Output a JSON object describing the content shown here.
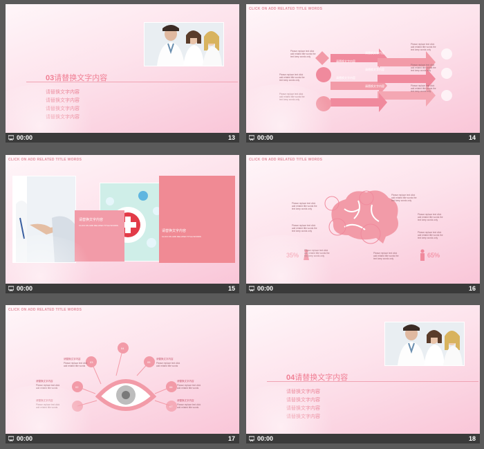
{
  "common": {
    "time": "00:00",
    "header_en": "CLICK ON ADD RELATED TITLE WORDS"
  },
  "slides": [
    {
      "num": "13",
      "section_num": "03",
      "section_title": "请替换文字内容",
      "items": [
        "请替换文字内容",
        "请替换文字内容",
        "请替换文字内容",
        "请替换文字内容"
      ]
    },
    {
      "num": "14",
      "arrow_label": "请替换文字内容",
      "blurb": "Please replace text click add related title words the text keep words only"
    },
    {
      "num": "15",
      "box_title": "请替换文字内容",
      "box_text": "CLICK ON ADD RELATED TITLE WORDS"
    },
    {
      "num": "16",
      "pct_left": "35%",
      "pct_right": "65%",
      "blurb": "Please replace text click add related title words the text keep words only"
    },
    {
      "num": "17",
      "eye_label": "请替换文字内容",
      "nodes": [
        "01",
        "02",
        "03",
        "04",
        "05",
        "06",
        "07"
      ],
      "blurb": "Please replace text click add related title words"
    },
    {
      "num": "18",
      "section_num": "04",
      "section_title": "请替换文字内容",
      "items": [
        "请替换文字内容",
        "请替换文字内容",
        "请替换文字内容",
        "请替换文字内容"
      ]
    }
  ],
  "colors": {
    "accent": "#f07f94",
    "pink_block": "#f29ba8",
    "bar": "#3a3a3a",
    "frame": "#5a5a5a"
  }
}
